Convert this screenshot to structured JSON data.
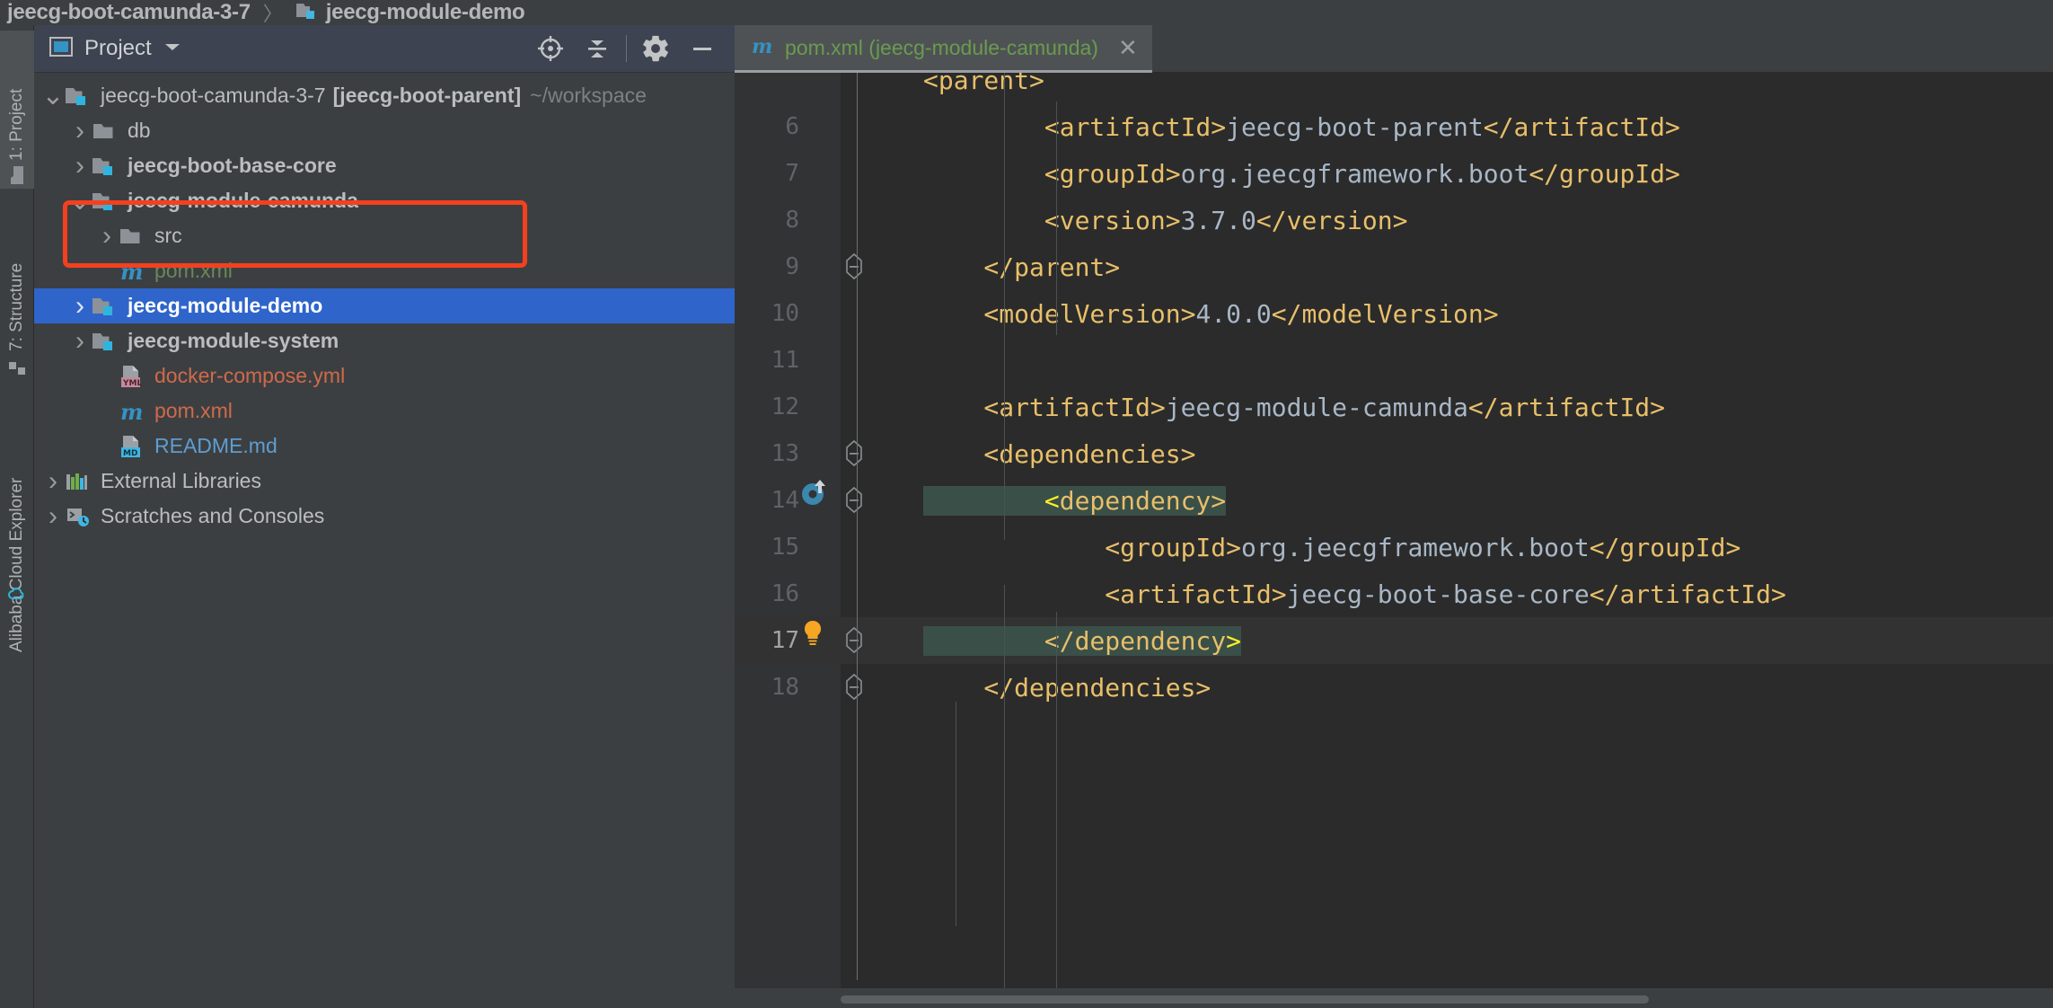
{
  "breadcrumb": {
    "items": [
      {
        "label": "jeecg-boot-camunda-3-7",
        "icon": "none"
      },
      {
        "label": "jeecg-module-demo",
        "icon": "module-folder-icon"
      }
    ],
    "separator": "〉"
  },
  "toolstrip": {
    "items": [
      {
        "label": "1: Project",
        "mnemonic": "1",
        "icon": "folder-icon",
        "active": true
      },
      {
        "label": "7: Structure",
        "mnemonic": "7",
        "icon": "structure-icon",
        "active": false
      },
      {
        "label": "Alibaba Cloud Explorer",
        "mnemonic": "",
        "icon": "cloud-icon",
        "active": false
      }
    ]
  },
  "project_panel": {
    "title": "Project",
    "view_icon": "project-view-icon",
    "dropdown_icon": "chevron-down-icon",
    "actions": [
      {
        "name": "locate-file-icon",
        "title": "Select Opened File"
      },
      {
        "name": "collapse-all-icon",
        "title": "Collapse All"
      },
      {
        "name": "settings-gear-icon",
        "title": "Settings"
      },
      {
        "name": "hide-panel-icon",
        "title": "Hide"
      }
    ],
    "tree": [
      {
        "label": "jeecg-boot-camunda-3-7",
        "bold_suffix": "[jeecg-boot-parent]",
        "path_suffix": "~/workspace",
        "indent": 0,
        "arrow": "down",
        "icon": "module-folder-icon",
        "color": "plain",
        "bold": false,
        "selected": false
      },
      {
        "label": "db",
        "indent": 1,
        "arrow": "right",
        "icon": "folder-icon",
        "color": "plain",
        "bold": false,
        "selected": false
      },
      {
        "label": "jeecg-boot-base-core",
        "indent": 1,
        "arrow": "right",
        "icon": "module-folder-icon",
        "color": "plain",
        "bold": true,
        "selected": false
      },
      {
        "label": "jeecg-module-camunda",
        "indent": 1,
        "arrow": "down",
        "icon": "module-folder-icon",
        "color": "plain",
        "bold": true,
        "selected": false
      },
      {
        "label": "src",
        "indent": 2,
        "arrow": "right",
        "icon": "folder-icon",
        "color": "plain",
        "bold": false,
        "selected": false
      },
      {
        "label": "pom.xml",
        "indent": 2,
        "arrow": "none",
        "icon": "maven-icon",
        "color": "green",
        "bold": false,
        "selected": false
      },
      {
        "label": "jeecg-module-demo",
        "indent": 1,
        "arrow": "right",
        "icon": "module-folder-icon",
        "color": "plain",
        "bold": true,
        "selected": true
      },
      {
        "label": "jeecg-module-system",
        "indent": 1,
        "arrow": "right",
        "icon": "module-folder-icon",
        "color": "plain",
        "bold": true,
        "selected": false
      },
      {
        "label": "docker-compose.yml",
        "indent": 2,
        "arrow": "none",
        "icon": "yml-file-icon",
        "color": "red",
        "bold": false,
        "selected": false
      },
      {
        "label": "pom.xml",
        "indent": 2,
        "arrow": "none",
        "icon": "maven-icon",
        "color": "red",
        "bold": false,
        "selected": false
      },
      {
        "label": "README.md",
        "indent": 2,
        "arrow": "none",
        "icon": "md-file-icon",
        "color": "blue",
        "bold": false,
        "selected": false
      },
      {
        "label": "External Libraries",
        "indent": 0,
        "arrow": "right",
        "icon": "libraries-icon",
        "color": "plain",
        "bold": false,
        "selected": false
      },
      {
        "label": "Scratches and Consoles",
        "indent": 0,
        "arrow": "right",
        "icon": "scratches-icon",
        "color": "plain",
        "bold": false,
        "selected": false
      }
    ],
    "annotation": {
      "color": "#f4401f",
      "shape": "rounded-rectangle"
    }
  },
  "editor": {
    "tab": {
      "filename": "pom.xml (jeecg-module-camunda)",
      "icon": "maven-icon",
      "close_icon": "close-icon"
    },
    "lines": [
      {
        "num": "",
        "indent": 8,
        "partial": true,
        "segments": [
          {
            "t": "tag",
            "s": "<parent>"
          }
        ]
      },
      {
        "num": "6",
        "indent": 0,
        "fold": false,
        "segments": [
          {
            "t": "tag",
            "s": "        <artifactId>"
          },
          {
            "t": "val",
            "s": "jeecg-boot-parent"
          },
          {
            "t": "tag",
            "s": "</artifactId>"
          }
        ]
      },
      {
        "num": "7",
        "indent": 0,
        "fold": false,
        "segments": [
          {
            "t": "tag",
            "s": "        <groupId>"
          },
          {
            "t": "val",
            "s": "org.jeecgframework.boot"
          },
          {
            "t": "tag",
            "s": "</groupId>"
          }
        ]
      },
      {
        "num": "8",
        "indent": 0,
        "fold": false,
        "segments": [
          {
            "t": "tag",
            "s": "        <version>"
          },
          {
            "t": "val",
            "s": "3.7.0"
          },
          {
            "t": "tag",
            "s": "</version>"
          }
        ]
      },
      {
        "num": "9",
        "indent": 0,
        "fold": true,
        "segments": [
          {
            "t": "tag",
            "s": "    </parent>"
          }
        ]
      },
      {
        "num": "10",
        "indent": 0,
        "fold": false,
        "segments": [
          {
            "t": "tag",
            "s": "    <modelVersion>"
          },
          {
            "t": "val",
            "s": "4.0.0"
          },
          {
            "t": "tag",
            "s": "</modelVersion>"
          }
        ]
      },
      {
        "num": "11",
        "indent": 0,
        "fold": false,
        "segments": []
      },
      {
        "num": "12",
        "indent": 0,
        "fold": false,
        "segments": [
          {
            "t": "tag",
            "s": "    <artifactId>"
          },
          {
            "t": "val",
            "s": "jeecg-module-camunda"
          },
          {
            "t": "tag",
            "s": "</artifactId>"
          }
        ]
      },
      {
        "num": "13",
        "indent": 0,
        "fold": true,
        "segments": [
          {
            "t": "tag",
            "s": "    <dependencies>"
          }
        ]
      },
      {
        "num": "14",
        "indent": 0,
        "fold": true,
        "maven_icon": true,
        "highlight": true,
        "segments": [
          {
            "t": "tag",
            "s": "        "
          },
          {
            "t": "hlbr",
            "s": "<"
          },
          {
            "t": "tag",
            "s": "dependency>"
          }
        ]
      },
      {
        "num": "15",
        "indent": 0,
        "fold": false,
        "segments": [
          {
            "t": "tag",
            "s": "            <groupId>"
          },
          {
            "t": "val",
            "s": "org.jeecgframework.boot"
          },
          {
            "t": "tag",
            "s": "</groupId>"
          }
        ]
      },
      {
        "num": "16",
        "indent": 0,
        "fold": false,
        "segments": [
          {
            "t": "tag",
            "s": "            <artifactId>"
          },
          {
            "t": "val",
            "s": "jeecg-boot-base-core"
          },
          {
            "t": "tag",
            "s": "</artifactId>"
          }
        ]
      },
      {
        "num": "17",
        "indent": 0,
        "fold": true,
        "bulb": true,
        "caret": true,
        "highlight": true,
        "segments": [
          {
            "t": "tag",
            "s": "        </dependency"
          },
          {
            "t": "hlbr",
            "s": ">"
          }
        ]
      },
      {
        "num": "18",
        "indent": 0,
        "fold": true,
        "segments": [
          {
            "t": "tag",
            "s": "    </dependencies>"
          }
        ]
      }
    ],
    "gutter_icons": {
      "maven_reimport": "maven-reimport-icon",
      "intention_bulb": "lightbulb-icon",
      "fold_collapse": "fold-collapse-icon"
    }
  },
  "colors": {
    "tag": "#e8bf6a",
    "value": "#a9b7c6",
    "selection_blue": "#2f65ca",
    "highlight_teal": "#3a4f47",
    "annotation_red": "#f4401f",
    "editor_bg": "#2b2b2b",
    "panel_bg": "#3c3f41"
  }
}
